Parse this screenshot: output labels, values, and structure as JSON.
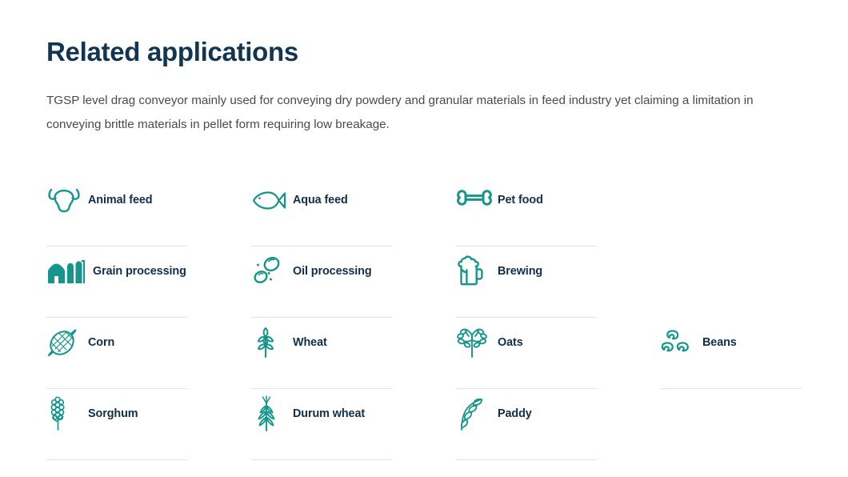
{
  "header": {
    "title": "Related applications"
  },
  "intro": {
    "text": "TGSP level drag conveyor mainly used for conveying dry powdery and granular materials in feed industry yet claiming a limitation in conveying brittle materials in pellet form requiring low breakage."
  },
  "colors": {
    "title": "#123651",
    "label": "#112f4a",
    "icon_teal": "#15958b",
    "body_text": "#4a4a4a",
    "divider": "#e2e4e6",
    "background": "#ffffff"
  },
  "applications": [
    {
      "label": "Animal feed",
      "icon": "cow-head-icon"
    },
    {
      "label": "Aqua feed",
      "icon": "fish-icon"
    },
    {
      "label": "Pet food",
      "icon": "bone-icon"
    },
    {
      "label": "Grain processing",
      "icon": "barn-silo-icon"
    },
    {
      "label": "Oil processing",
      "icon": "oil-droplets-icon"
    },
    {
      "label": "Brewing",
      "icon": "beer-mug-icon"
    },
    {
      "label": "Corn",
      "icon": "corn-cob-icon"
    },
    {
      "label": "Wheat",
      "icon": "wheat-head-icon"
    },
    {
      "label": "Oats",
      "icon": "oat-stalk-icon"
    },
    {
      "label": "Beans",
      "icon": "beans-icon"
    },
    {
      "label": "Sorghum",
      "icon": "sorghum-icon"
    },
    {
      "label": "Durum wheat",
      "icon": "durum-wheat-icon"
    },
    {
      "label": "Paddy",
      "icon": "paddy-rice-icon"
    }
  ]
}
